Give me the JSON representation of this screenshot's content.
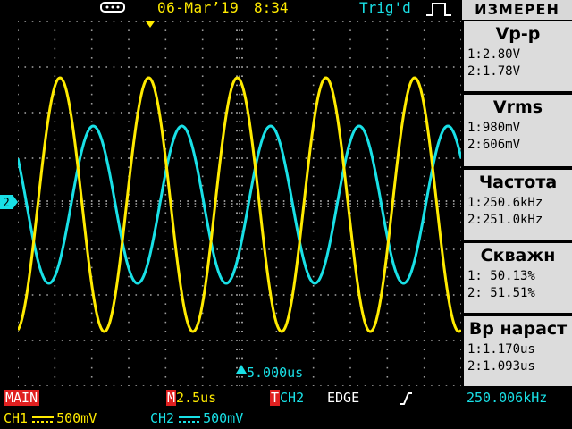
{
  "status_bar": {
    "usb_icon": "usb-icon",
    "date": "06-Mar’19",
    "time": "8:34",
    "trigger_status": "Trig'd",
    "trigger_icon": "rising-edge-icon"
  },
  "measure_menu": {
    "header": "ИЗМЕРЕН",
    "panels": [
      {
        "title": "Vp-p",
        "ch1": "1:2.80V",
        "ch2": "2:1.78V"
      },
      {
        "title": "Vrms",
        "ch1": "1:980mV",
        "ch2": "2:606mV"
      },
      {
        "title": "Частота",
        "ch1": "1:250.6kHz",
        "ch2": "2:251.0kHz"
      },
      {
        "title": "Скважн",
        "ch1": "1: 50.13%",
        "ch2": "2: 51.51%"
      },
      {
        "title": "Вр нараст",
        "ch1": "1:1.170us",
        "ch2": "2:1.093us"
      }
    ]
  },
  "waveform": {
    "trigger_marker_label": "2",
    "time_offset_label": "5.000us",
    "ch1_color": "#ffea00",
    "ch2_color": "#19e0e6",
    "ch1_cycles_on_screen": 5.0,
    "ch2_cycles_on_screen": 5.0
  },
  "bottom": {
    "mode": "MAIN",
    "timebase_prefix": "M",
    "timebase": "2.5us",
    "trigger_prefix": "T",
    "trigger_source": "CH2",
    "trigger_type": "EDGE",
    "trigger_frequency": "250.006kHz",
    "ch1_label": "CH1",
    "ch1_scale": "500mV",
    "ch2_label": "CH2",
    "ch2_scale": "500mV"
  }
}
